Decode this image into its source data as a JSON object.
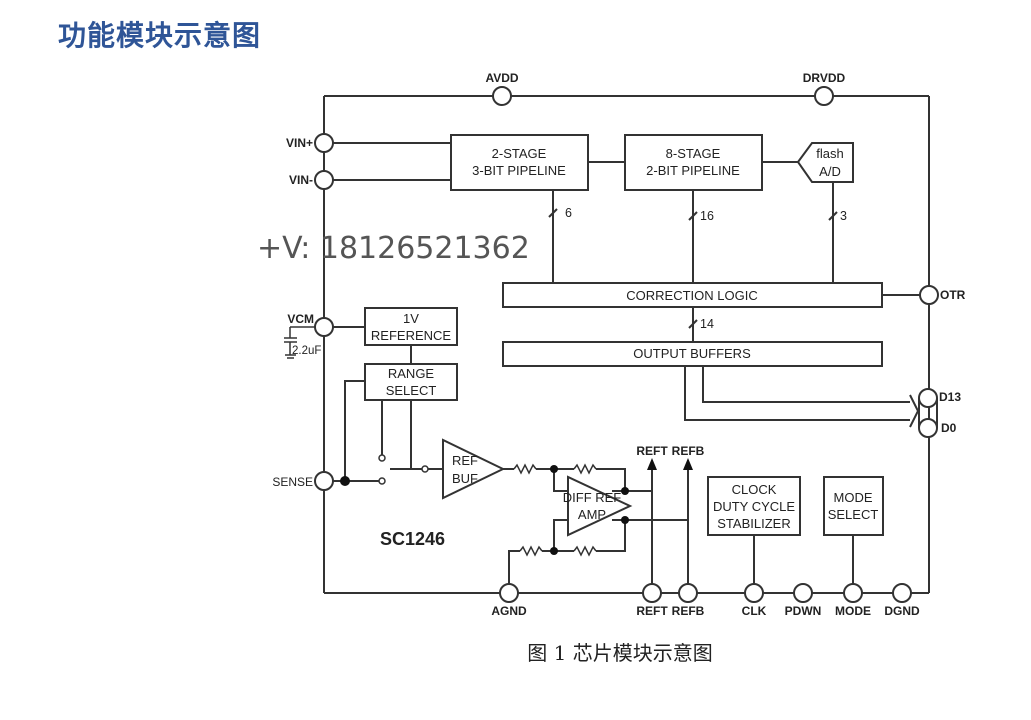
{
  "page": {
    "title": "功能模块示意图",
    "caption": "图 1 芯片模块示意图",
    "title_color": "#2f5597",
    "watermark": "+V:  18126521362"
  },
  "diagram": {
    "chip_name": "SC1246",
    "blocks": {
      "pipeline1": [
        "2-STAGE",
        "3-BIT PIPELINE"
      ],
      "pipeline2": [
        "8-STAGE",
        "2-BIT PIPELINE"
      ],
      "flash": [
        "flash",
        "A/D"
      ],
      "correction": "CORRECTION LOGIC",
      "output_buffers": "OUTPUT BUFFERS",
      "reference": [
        "1V",
        "REFERENCE"
      ],
      "range_select": [
        "RANGE",
        "SELECT"
      ],
      "ref_buf": [
        "REF",
        "BUF"
      ],
      "diff_ref_amp": [
        "DIFF REF",
        "AMP"
      ],
      "clock_stabilizer": [
        "CLOCK",
        "DUTY CYCLE",
        "STABILIZER"
      ],
      "mode_select": [
        "MODE",
        "SELECT"
      ]
    },
    "bus_widths": {
      "pipeline1": "6",
      "pipeline2": "16",
      "flash": "3",
      "correction": "14"
    },
    "pins": {
      "avdd": "AVDD",
      "drvdd": "DRVDD",
      "vin_plus": "VIN+",
      "vin_minus": "VIN-",
      "vcm": "VCM",
      "vcm_cap": "2.2uF",
      "sense": "SENSE",
      "otr": "OTR",
      "d13": "D13",
      "d0": "D0",
      "agnd": "AGND",
      "reft_bottom": "REFT",
      "refb_bottom": "REFB",
      "clk": "CLK",
      "pdwn": "PDWN",
      "mode": "MODE",
      "dgnd": "DGND",
      "reft_top": "REFT",
      "refb_top": "REFB"
    }
  }
}
